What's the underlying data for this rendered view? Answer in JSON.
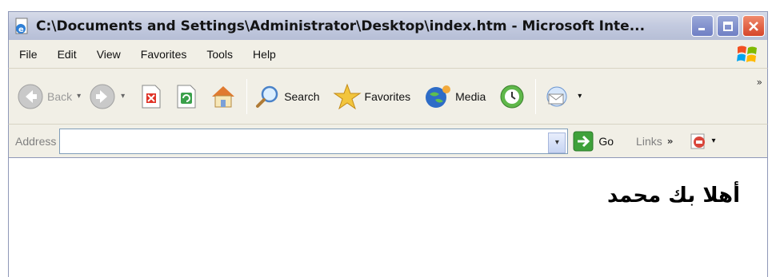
{
  "window": {
    "title": "C:\\Documents and Settings\\Administrator\\Desktop\\index.htm - Microsoft Inte..."
  },
  "menu": {
    "items": [
      "File",
      "Edit",
      "View",
      "Favorites",
      "Tools",
      "Help"
    ]
  },
  "toolbar": {
    "back_label": "Back",
    "search_label": "Search",
    "favorites_label": "Favorites",
    "media_label": "Media"
  },
  "address": {
    "label": "Address",
    "value": "",
    "go_label": "Go",
    "links_label": "Links"
  },
  "content": {
    "text": "أهلا بك محمد"
  },
  "colors": {
    "title_text": "#141414",
    "bar_bg": "#f1efe6",
    "frame_border": "#8f98b8",
    "close_button": "#d5452a",
    "disabled_text": "#9a9a9a"
  },
  "icons": {
    "title": "ie-page-icon",
    "back": "back-arrow-icon",
    "forward": "forward-arrow-icon",
    "stop": "stop-icon",
    "refresh": "refresh-icon",
    "home": "home-icon",
    "search": "search-icon",
    "favorites": "star-icon",
    "media": "media-icon",
    "history": "history-icon",
    "mail": "mail-icon",
    "go": "go-arrow-icon",
    "windows_logo": "windows-flag-icon"
  }
}
